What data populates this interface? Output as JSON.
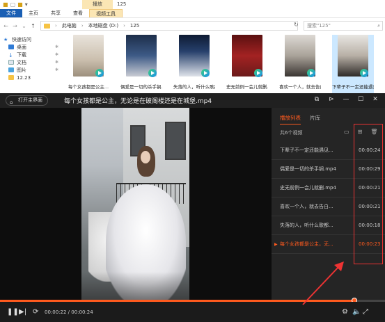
{
  "explorer": {
    "context_tab": "播放",
    "title": "125",
    "tabs": [
      "文件",
      "主页",
      "共享",
      "查看",
      "视频工具"
    ],
    "path": [
      "此电脑",
      "本地磁盘 (D:)",
      "125"
    ],
    "search_placeholder": "搜索\"125\"",
    "nav": [
      {
        "label": "快速访问"
      },
      {
        "label": "桌面"
      },
      {
        "label": "下载"
      },
      {
        "label": "文档"
      },
      {
        "label": "图片"
      },
      {
        "label": "12.23"
      }
    ],
    "files": [
      {
        "name": "每个女孩都是公主..."
      },
      {
        "name": "偶爱是一切的杀手锏..."
      },
      {
        "name": "失落的人，听什么歌都..."
      },
      {
        "name": "史无前例一会儿就删..."
      },
      {
        "name": "喜欢一个人，就去告白..."
      },
      {
        "name": "下辈子不一定还能遇见..."
      }
    ]
  },
  "player": {
    "home_label": "打开主界面",
    "title": "每个女孩都是公主，无论是在破阁楼还是在城堡.mp4",
    "tabs": {
      "playlist": "播放列表",
      "library": "片库"
    },
    "count_label": "共6个视频",
    "playlist": [
      {
        "name": "下辈子不一定还能遇见...",
        "duration": "00:00:24"
      },
      {
        "name": "偶爱是一切的杀手锏.mp4",
        "duration": "00:00:29"
      },
      {
        "name": "史无前例一会儿就删.mp4",
        "duration": "00:00:21"
      },
      {
        "name": "喜欢一个人，就去告白...",
        "duration": "00:00:21"
      },
      {
        "name": "失落的人，听什么歌都...",
        "duration": "00:00:18"
      },
      {
        "name": "每个女孩都是公主，无...",
        "duration": "00:00:23",
        "current": true
      }
    ],
    "progress": {
      "fraction": 0.92
    },
    "time_display": "00:00:22 / 00:00:24",
    "accent": "#ff5a1e",
    "annotation_color": "#ee3333"
  }
}
